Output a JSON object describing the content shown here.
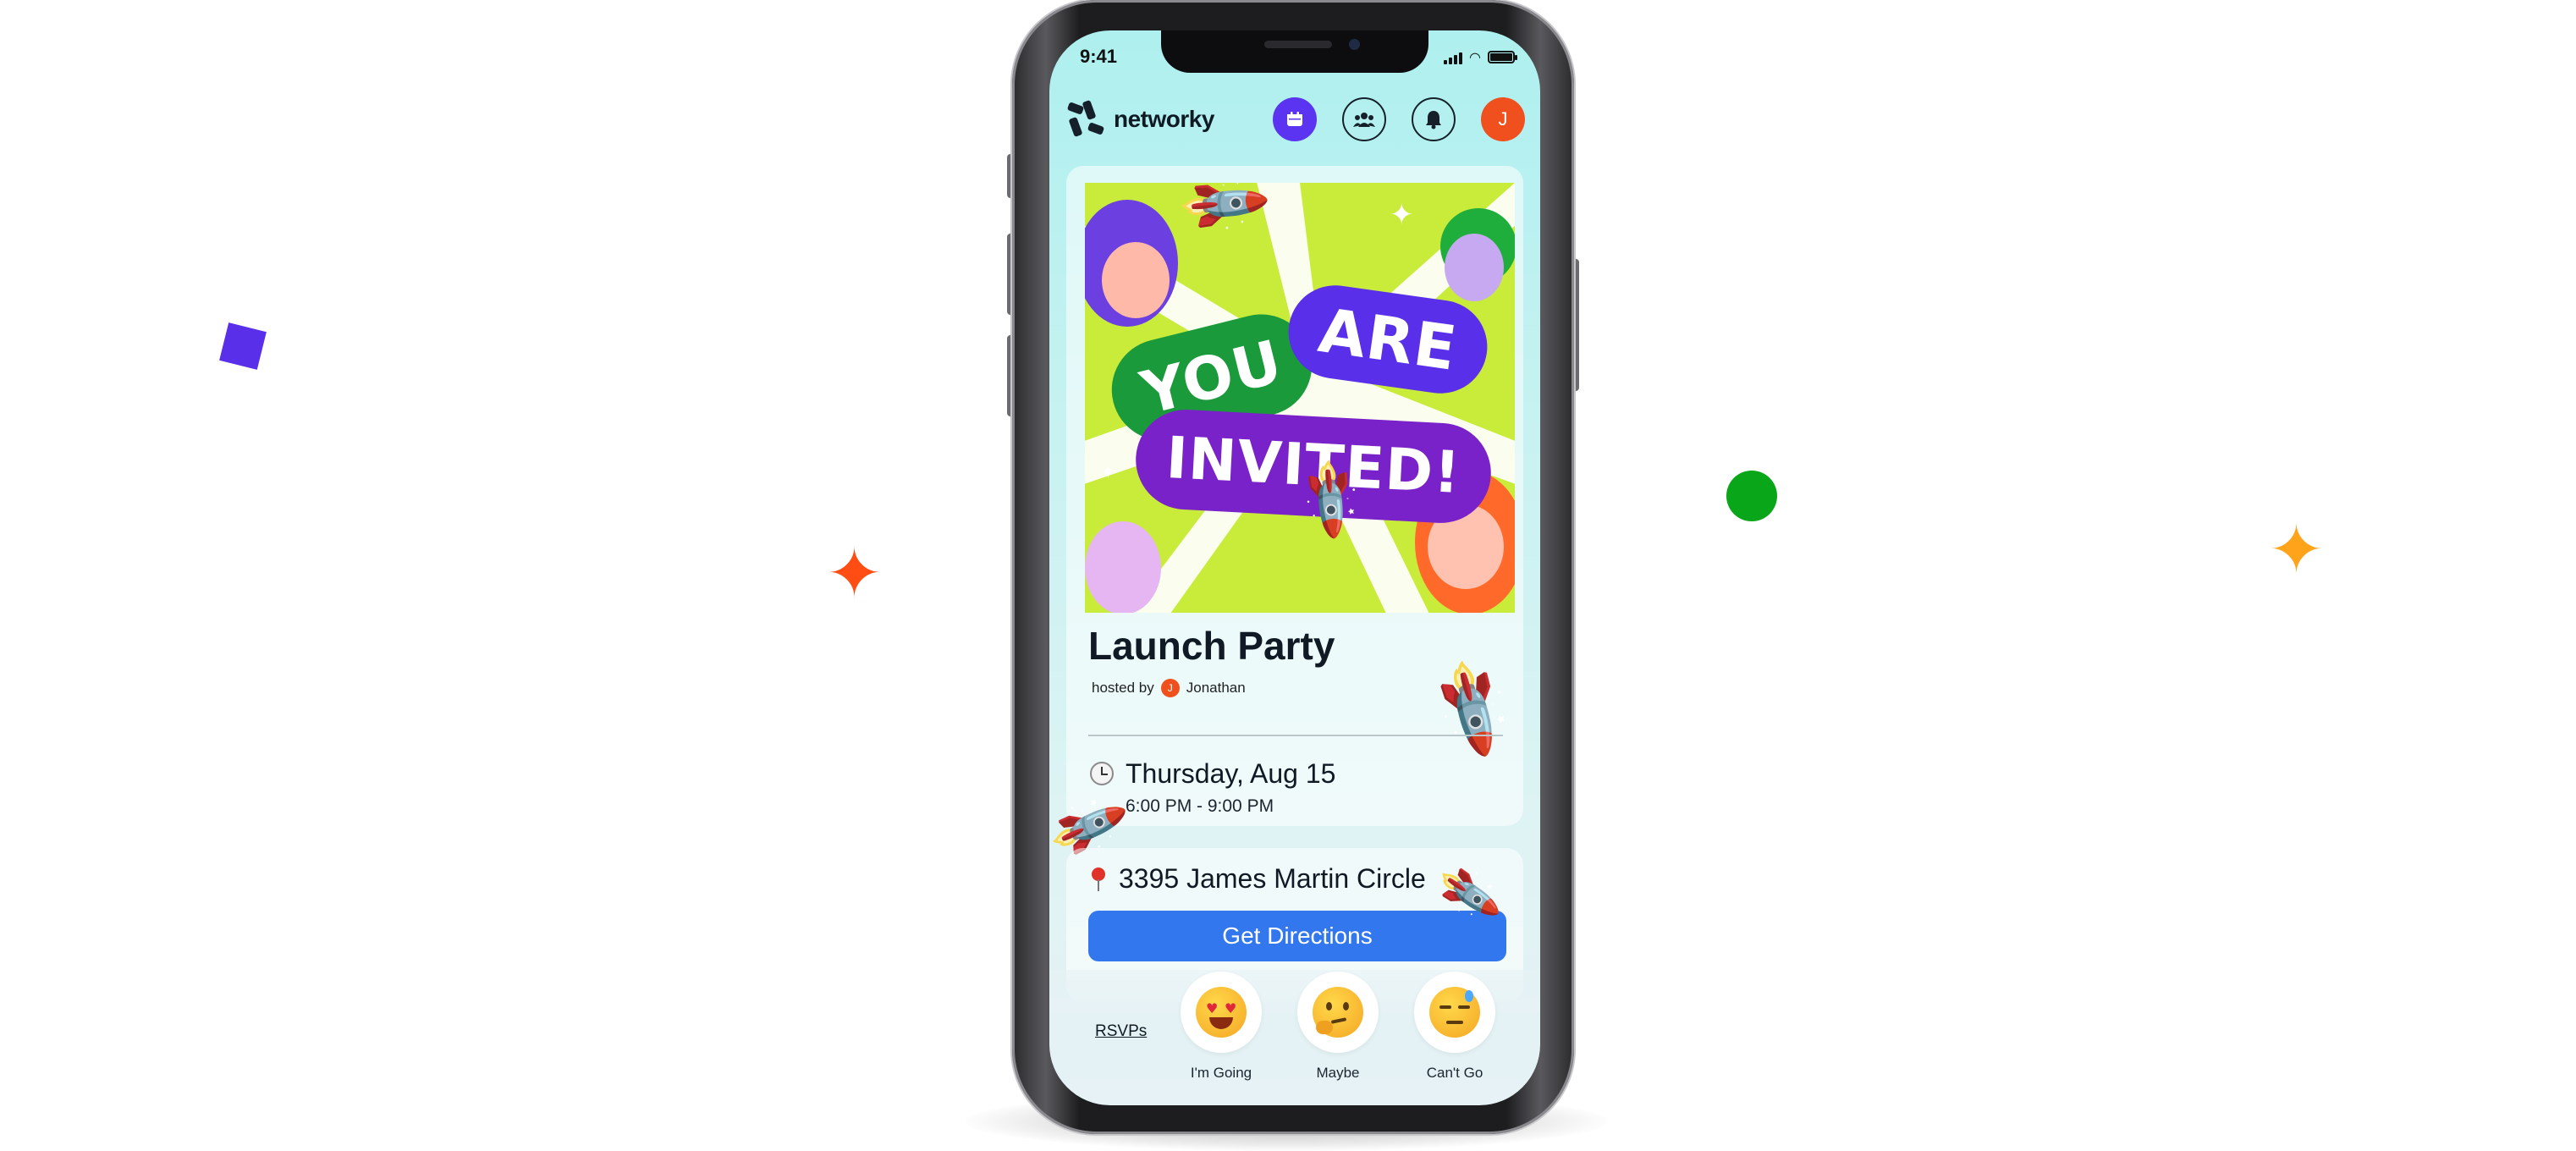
{
  "status_bar": {
    "time": "9:41"
  },
  "app": {
    "name": "networky"
  },
  "header": {
    "nav": [
      {
        "icon": "calendar-icon",
        "glyph": "▣",
        "active": true
      },
      {
        "icon": "groups-icon",
        "glyph": "☗",
        "active": false
      },
      {
        "icon": "bell-icon",
        "glyph": "♪",
        "active": false
      }
    ],
    "avatar_initial": "J"
  },
  "banner": {
    "words": [
      "YOU",
      "ARE",
      "INVITED!"
    ],
    "colors": {
      "background": "#c9ec3a",
      "you": "#1a9a3b",
      "are": "#5a2fe9",
      "invited": "#7a22c9"
    }
  },
  "event": {
    "title": "Launch Party",
    "hosted_by_label": "hosted by",
    "host_initial": "J",
    "host_name": "Jonathan",
    "date": "Thursday, Aug 15",
    "time_range": "6:00 PM - 9:00 PM",
    "address": "3395 James Martin Circle",
    "directions_label": "Get Directions"
  },
  "rsvp": {
    "link_label": "RSVPs",
    "options": [
      {
        "label": "I'm Going",
        "icon": "heart-eyes-emoji-icon"
      },
      {
        "label": "Maybe",
        "icon": "thinking-emoji-icon"
      },
      {
        "label": "Can't Go",
        "icon": "sad-sweat-emoji-icon"
      }
    ]
  },
  "colors": {
    "accent": "#5a34f0",
    "avatar": "#f0501e",
    "button": "#3377ee"
  }
}
